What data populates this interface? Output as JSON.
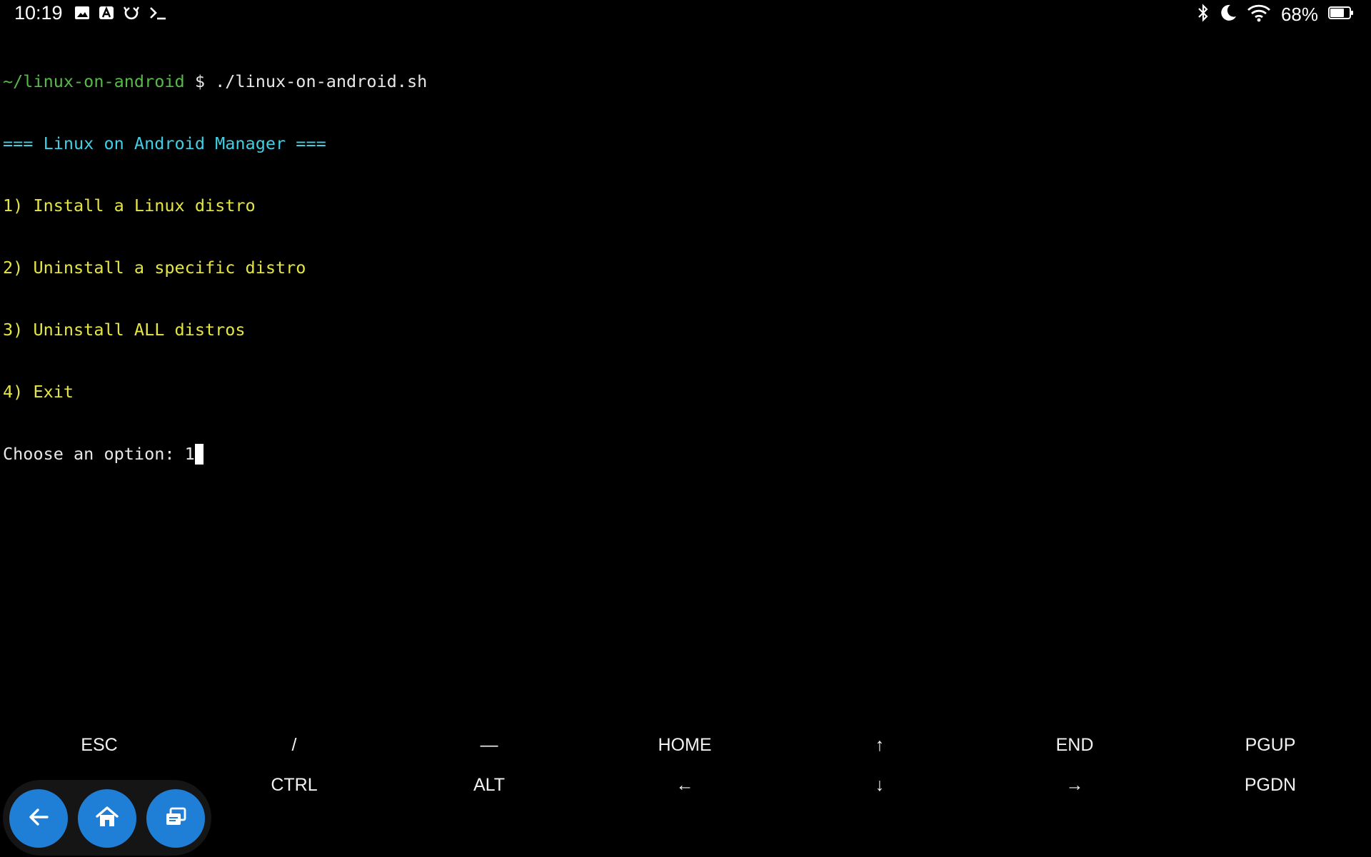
{
  "status_bar": {
    "time": "10:19",
    "notification_icons": [
      "gallery-icon",
      "a-badge-icon",
      "refresh-icon",
      "terminal-icon"
    ],
    "system_icons": [
      "bluetooth-icon",
      "do-not-disturb-moon-icon",
      "wifi-icon",
      "battery-icon"
    ],
    "battery_percent": "68%"
  },
  "terminal": {
    "prompt_path": "~/linux-on-android",
    "prompt_sign": " $ ",
    "command": "./linux-on-android.sh",
    "header": "=== Linux on Android Manager ===",
    "menu": [
      "1) Install a Linux distro",
      "2) Uninstall a specific distro",
      "3) Uninstall ALL distros",
      "4) Exit"
    ],
    "input_prompt": "Choose an option: ",
    "input_value": "1",
    "colors": {
      "path": "#58b94a",
      "header": "#3fd0e6",
      "menu": "#e6e641",
      "text": "#e8e8e8"
    }
  },
  "extra_keys": {
    "row1": [
      "ESC",
      "/",
      "—",
      "HOME",
      "↑",
      "END",
      "PGUP"
    ],
    "row2": [
      "",
      "CTRL",
      "ALT",
      "←",
      "↓",
      "→",
      "PGDN"
    ]
  },
  "nav": {
    "buttons": [
      "back-arrow-icon",
      "home-icon",
      "recent-apps-icon"
    ],
    "accent": "#1f7fd6"
  }
}
